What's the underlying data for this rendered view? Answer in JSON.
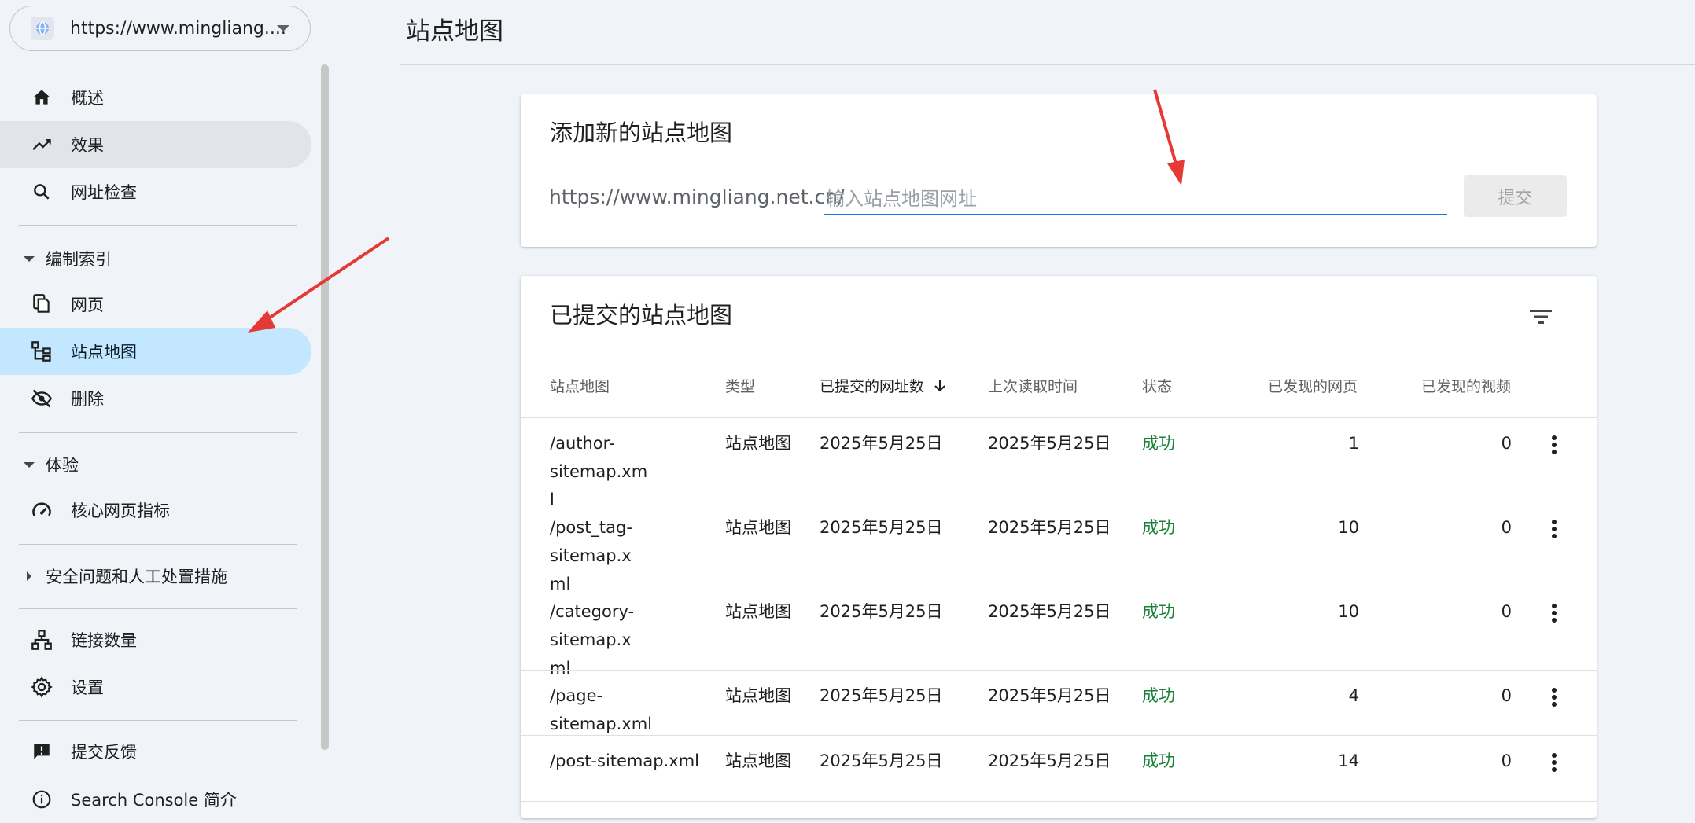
{
  "sidebar": {
    "property": "https://www.mingliang....",
    "items": {
      "overview": "概述",
      "performance": "效果",
      "url_inspection": "网址检查",
      "indexing_section": "编制索引",
      "pages": "网页",
      "sitemaps": "站点地图",
      "removals": "删除",
      "experience_section": "体验",
      "core_web_vitals": "核心网页指标",
      "security_section": "安全问题和人工处置措施",
      "links": "链接数量",
      "settings": "设置",
      "feedback": "提交反馈",
      "about": "Search Console 简介"
    }
  },
  "header": {
    "title": "站点地图"
  },
  "add_card": {
    "title": "添加新的站点地图",
    "url_prefix": "https://www.mingliang.net.cn/",
    "placeholder": "输入站点地图网址",
    "submit_label": "提交"
  },
  "list_card": {
    "title": "已提交的站点地图",
    "columns": {
      "sitemap": "站点地图",
      "type": "类型",
      "submitted": "已提交的网址数",
      "last_read": "上次读取时间",
      "status": "状态",
      "pages": "已发现的网页",
      "videos": "已发现的视频"
    },
    "rows": [
      {
        "sitemap_line1": "/author-sitemap.xm",
        "sitemap_line2": "l",
        "type": "站点地图",
        "submitted": "2025年5月25日",
        "last_read": "2025年5月25日",
        "status": "成功",
        "pages": "1",
        "videos": "0"
      },
      {
        "sitemap_line1": "/post_tag-sitemap.x",
        "sitemap_line2": "ml",
        "type": "站点地图",
        "submitted": "2025年5月25日",
        "last_read": "2025年5月25日",
        "status": "成功",
        "pages": "10",
        "videos": "0"
      },
      {
        "sitemap_line1": "/category-sitemap.x",
        "sitemap_line2": "ml",
        "type": "站点地图",
        "submitted": "2025年5月25日",
        "last_read": "2025年5月25日",
        "status": "成功",
        "pages": "10",
        "videos": "0"
      },
      {
        "sitemap_line1": "/page-sitemap.xml",
        "sitemap_line2": "",
        "type": "站点地图",
        "submitted": "2025年5月25日",
        "last_read": "2025年5月25日",
        "status": "成功",
        "pages": "4",
        "videos": "0"
      },
      {
        "sitemap_line1": "/post-sitemap.xml",
        "sitemap_line2": "",
        "type": "站点地图",
        "submitted": "2025年5月25日",
        "last_read": "2025年5月25日",
        "status": "成功",
        "pages": "14",
        "videos": "0"
      }
    ]
  },
  "colors": {
    "active_nav": "#c2e7ff",
    "success": "#188038",
    "input_underline": "#1a73e8",
    "annotation_arrow": "#e53935"
  }
}
